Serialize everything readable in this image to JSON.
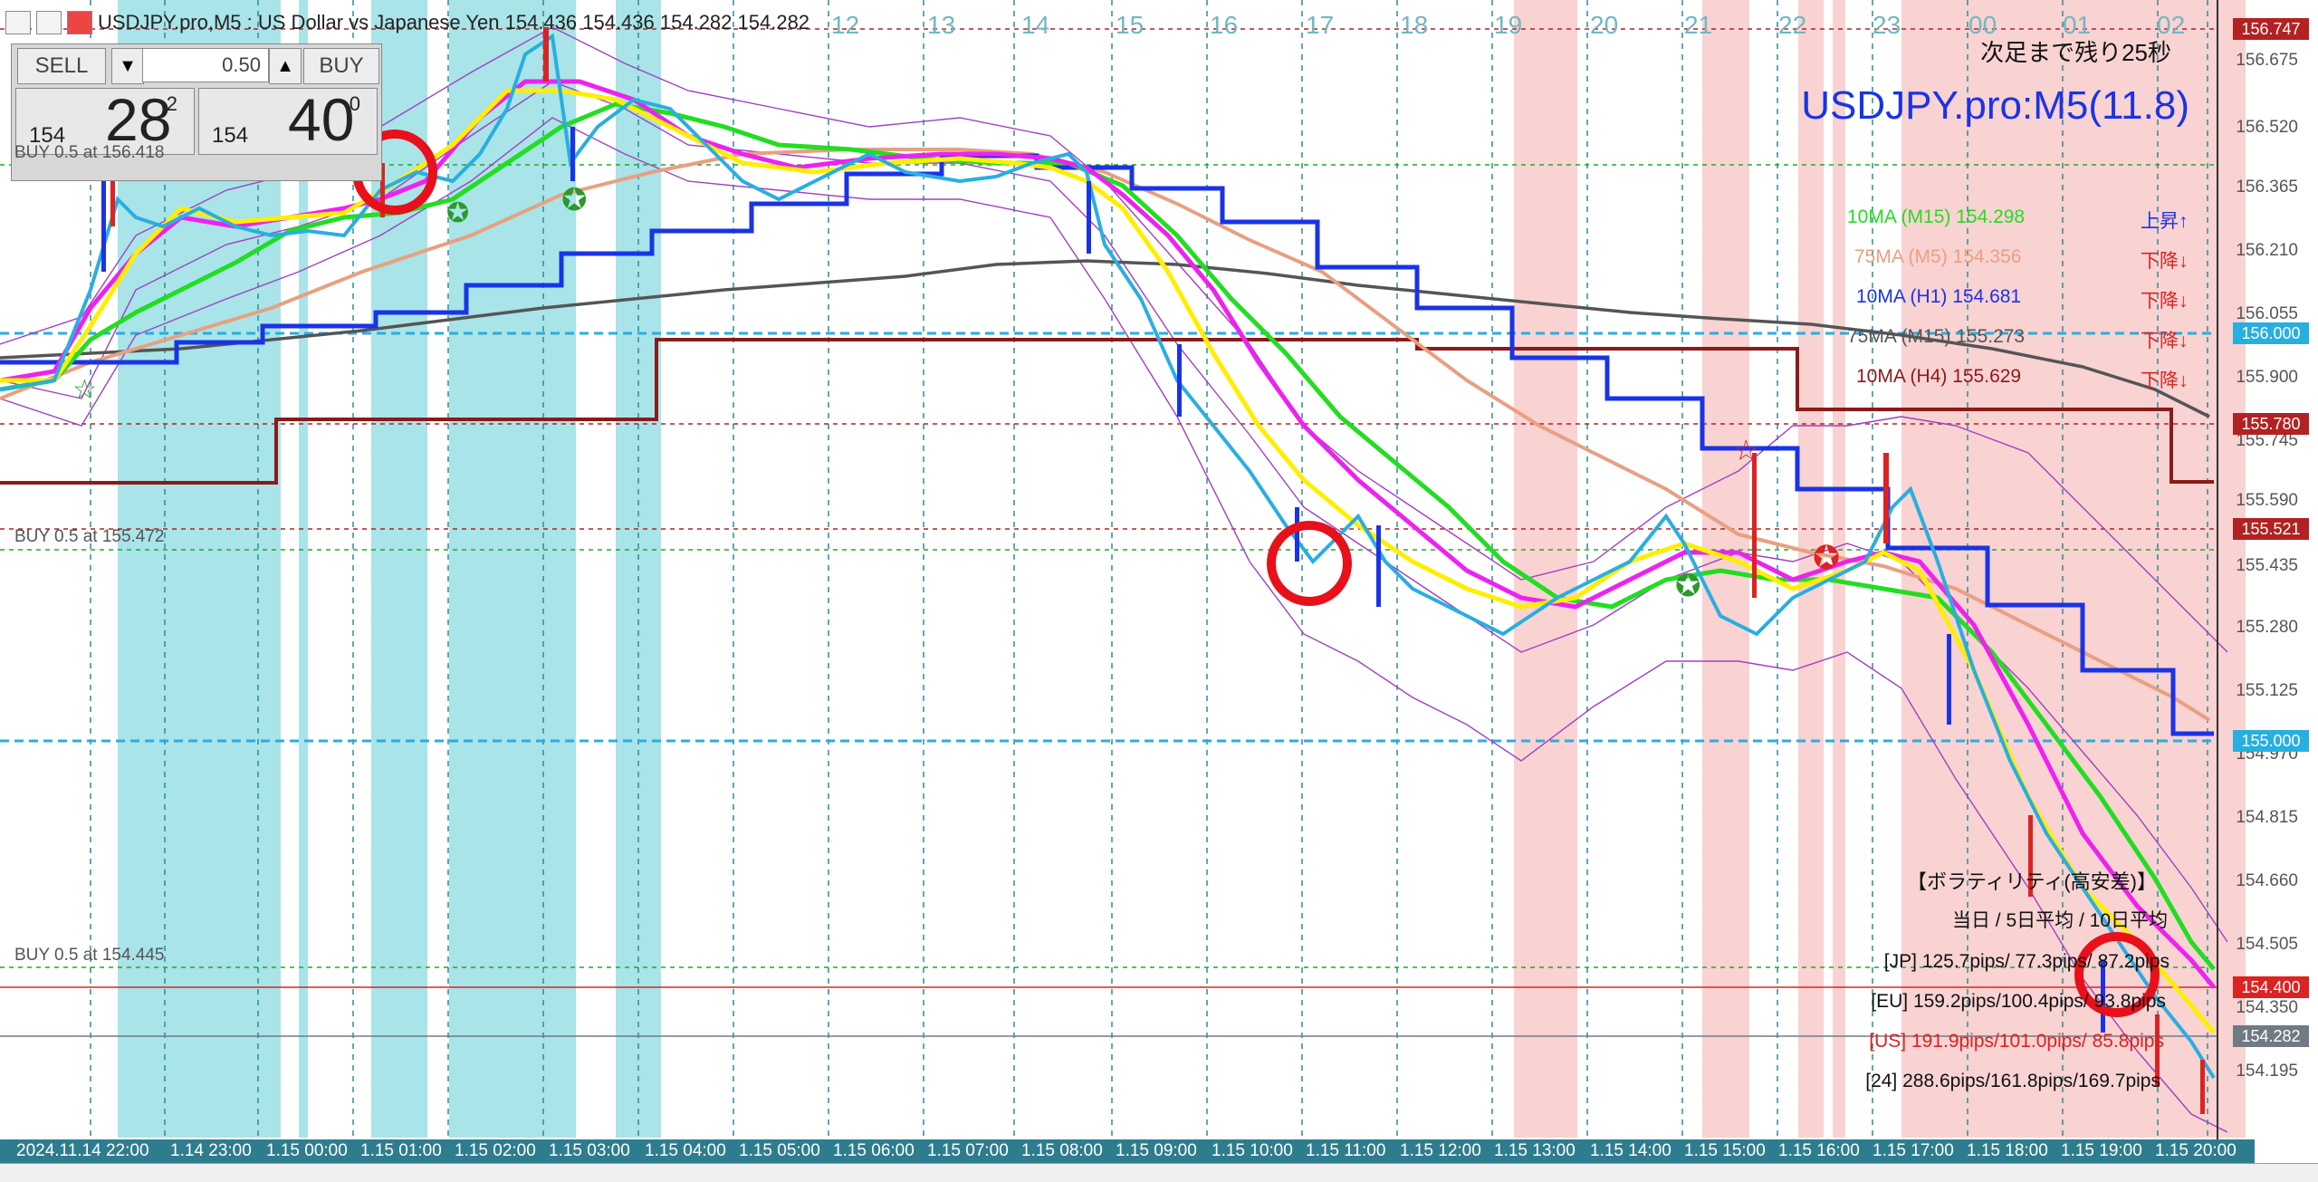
{
  "window": {
    "title": "USDJPY.pro,M5 : US Dollar vs Japanese Yen 154.436 154.436 154.282 154.282"
  },
  "trade_panel": {
    "sell_label": "SELL",
    "buy_label": "BUY",
    "lot_value": "0.50",
    "sell_price_small": "154",
    "sell_price_big": "28",
    "sell_price_sup": "2",
    "buy_price_small": "154",
    "buy_price_big": "40",
    "buy_price_sup": "0"
  },
  "countdown": "次足まで残り25秒",
  "symbol_title": "USDJPY.pro:M5(11.8)",
  "ma_legend": [
    {
      "label": "10MA (M15) 154.298",
      "trend": "上昇↑",
      "color": "#22dd22",
      "trend_color": "#1a33e6"
    },
    {
      "label": "75MA (M5) 154.356",
      "trend": "下降↓",
      "color": "#e8a080",
      "trend_color": "#dd2222"
    },
    {
      "label": "10MA (H1) 154.681",
      "trend": "下降↓",
      "color": "#1a33e6",
      "trend_color": "#dd2222"
    },
    {
      "label": "75MA (M15) 155.273",
      "trend": "下降↓",
      "color": "#555555",
      "trend_color": "#dd2222"
    },
    {
      "label": "10MA (H4) 155.629",
      "trend": "下降↓",
      "color": "#8b1a1a",
      "trend_color": "#dd2222"
    }
  ],
  "buy_lines": [
    {
      "label": "BUY 0.5 at 156.418"
    },
    {
      "label": "BUY 0.5 at 155.472"
    },
    {
      "label": "BUY 0.5 at 154.445"
    }
  ],
  "price_axis": {
    "ticks": [
      "156.675",
      "156.520",
      "156.365",
      "156.210",
      "156.055",
      "155.900",
      "155.745",
      "155.590",
      "155.435",
      "155.280",
      "155.125",
      "154.970",
      "154.815",
      "154.660",
      "154.505",
      "154.350",
      "154.195"
    ],
    "tags": [
      {
        "value": "156.747",
        "color": "#b22222"
      },
      {
        "value": "156.000",
        "color": "#29aee0"
      },
      {
        "value": "155.780",
        "color": "#b22222"
      },
      {
        "value": "155.521",
        "color": "#b22222"
      },
      {
        "value": "155.000",
        "color": "#29aee0"
      },
      {
        "value": "154.400",
        "color": "#dd2222"
      },
      {
        "value": "154.282",
        "color": "#707a85"
      }
    ]
  },
  "time_axis": [
    "2024.11.14 22:00",
    "1.14 23:00",
    "1.15 00:00",
    "1.15 01:00",
    "1.15 02:00",
    "1.15 03:00",
    "1.15 04:00",
    "1.15 05:00",
    "1.15 06:00",
    "1.15 07:00",
    "1.15 08:00",
    "1.15 09:00",
    "1.15 10:00",
    "1.15 11:00",
    "1.15 12:00",
    "1.15 13:00",
    "1.15 14:00",
    "1.15 15:00",
    "1.15 16:00",
    "1.15 17:00",
    "1.15 18:00",
    "1.15 19:00",
    "1.15 20:00"
  ],
  "top_dates": [
    "12",
    "13",
    "14",
    "15",
    "16",
    "17",
    "18",
    "19",
    "20",
    "21",
    "22",
    "23",
    "00",
    "01",
    "02"
  ],
  "volatility": {
    "title": "【ボラティリティ(高安差)】",
    "subtitle": "当日 / 5日平均 / 10日平均",
    "rows": [
      {
        "text": "[JP] 125.7pips/ 77.3pips/ 87.2pips",
        "color": "#111111"
      },
      {
        "text": "[EU] 159.2pips/100.4pips/ 93.8pips",
        "color": "#111111"
      },
      {
        "text": "[US] 191.9pips/101.0pips/ 85.8pips",
        "color": "#dd2222"
      },
      {
        "text": "[24] 288.6pips/161.8pips/169.7pips",
        "color": "#111111"
      }
    ]
  },
  "colors": {
    "background": "#ffffff",
    "tokyo_session": "#a8e4e8",
    "ny_session": "#f9d2d2",
    "grid": "#2e8b98",
    "price_axis_bar": "#2e7d8f"
  }
}
